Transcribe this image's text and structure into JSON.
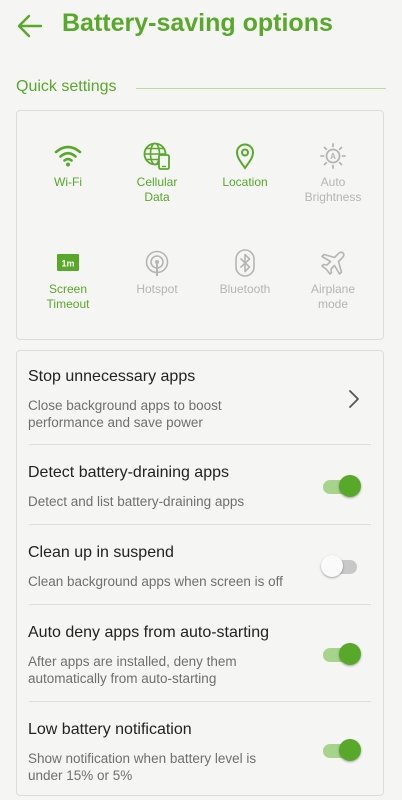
{
  "header": {
    "title": "Battery-saving options",
    "back_icon": "arrow-left-icon"
  },
  "colors": {
    "accent": "#58a82a",
    "accent_light": "#a8d38c",
    "disabled": "#b5b5b5",
    "background": "#f5f5f3"
  },
  "quick_settings": {
    "title": "Quick settings",
    "tiles": [
      {
        "label": "Wi-Fi",
        "icon": "wifi-icon",
        "enabled": true
      },
      {
        "label": "Cellular\nData",
        "icon": "cellular-data-icon",
        "enabled": true
      },
      {
        "label": "Location",
        "icon": "location-icon",
        "enabled": true
      },
      {
        "label": "Auto\nBrightness",
        "icon": "auto-brightness-icon",
        "enabled": false
      },
      {
        "label": "Screen\nTimeout",
        "icon": "screen-timeout-icon",
        "badge": "1m",
        "enabled": true
      },
      {
        "label": "Hotspot",
        "icon": "hotspot-icon",
        "enabled": false
      },
      {
        "label": "Bluetooth",
        "icon": "bluetooth-icon",
        "enabled": false
      },
      {
        "label": "Airplane\nmode",
        "icon": "airplane-icon",
        "enabled": false
      }
    ]
  },
  "settings": [
    {
      "title": "Stop unnecessary apps",
      "subtitle": "Close background apps to boost\nperformance and save power",
      "control": "chevron"
    },
    {
      "title": "Detect battery-draining apps",
      "subtitle": "Detect and list battery-draining apps",
      "control": "toggle",
      "on": true
    },
    {
      "title": "Clean up in suspend",
      "subtitle": "Clean background apps when screen is off",
      "control": "toggle",
      "on": false
    },
    {
      "title": "Auto deny apps from auto-starting",
      "subtitle": "After apps are installed, deny them\nautomatically from auto-starting",
      "control": "toggle",
      "on": true
    },
    {
      "title": "Low battery notification",
      "subtitle": "Show notification when battery level is\nunder 15% or 5%",
      "control": "toggle",
      "on": true
    }
  ]
}
